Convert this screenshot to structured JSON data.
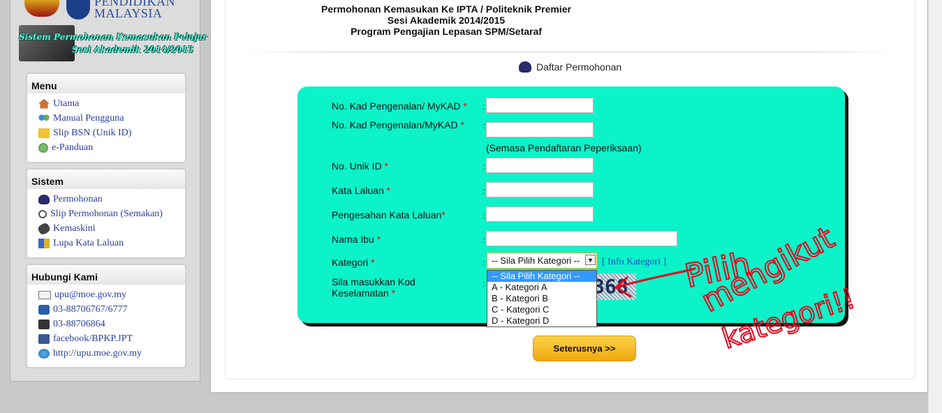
{
  "header": {
    "logo_text_1": "PENDIDIKAN",
    "logo_text_2": "MALAYSIA",
    "banner_line_1": "Sistem Permohonan Kemasukan Pelajar",
    "banner_line_2": "Sesi Akademik 2014/2015"
  },
  "sidebar": {
    "menu": {
      "title": "Menu",
      "items": [
        "Utama",
        "Manual Pengguna",
        "Slip BSN (Unik ID)",
        "e-Panduan"
      ]
    },
    "sistem": {
      "title": "Sistem",
      "items": [
        "Permohonan",
        "Slip Permohonan (Semakan)",
        "Kemaskini",
        "Lupa Kata Laluan"
      ]
    },
    "hubungi": {
      "title": "Hubungi Kami",
      "items": [
        "upu@moe.gov.my",
        "03-88706767/6777",
        "03-88706864",
        "facebook/BPKP.JPT",
        "http://upu.moe.gov.my"
      ]
    }
  },
  "main": {
    "title_line_1": "Permohonan Kemasukan Ke IPTA / Politeknik Premier",
    "title_line_2": "Sesi Akademik 2014/2015",
    "title_line_3": "Program Pengajian Lepasan SPM/Setaraf",
    "section_label": "Daftar Permohonan"
  },
  "form": {
    "required_mark": "*",
    "colon": ":",
    "fields": {
      "ic_no": {
        "label": "No. Kad Pengenalan/ MyKAD",
        "value": ""
      },
      "ic_no_exam": {
        "label": "No. Kad Pengenalan/MyKAD",
        "value": "",
        "note": "(Semasa Pendaftaran Peperiksaan)"
      },
      "unik_id": {
        "label": "No. Unik ID",
        "value": ""
      },
      "password": {
        "label": "Kata Laluan",
        "value": ""
      },
      "password_confirm": {
        "label": "Pengesahan Kata Laluan",
        "value": ""
      },
      "mother_name": {
        "label": "Nama Ibu",
        "value": ""
      },
      "kategori": {
        "label": "Kategori",
        "selected": "-- Sila Pilih Kategori --",
        "info_link": "[ Info Kategori ]",
        "options": [
          "-- Sila Pilih Kategori --",
          "A - Kategori A",
          "B - Kategori B",
          "C - Kategori C",
          "D - Kategori D"
        ]
      },
      "security_code": {
        "label_1": "Sila masukkan Kod",
        "label_2": "Keselamatan",
        "captcha_text": "368"
      }
    },
    "submit_label": "Seterusnya >>"
  },
  "annotation": {
    "line_1": "Pilih",
    "line_2": "mengikut",
    "line_3": "kategori!!",
    "color": "#e3061c"
  },
  "colors": {
    "form_background": "#0cf3c9",
    "link_color": "#2b3f9a",
    "submit_button": "#f5b82a"
  }
}
